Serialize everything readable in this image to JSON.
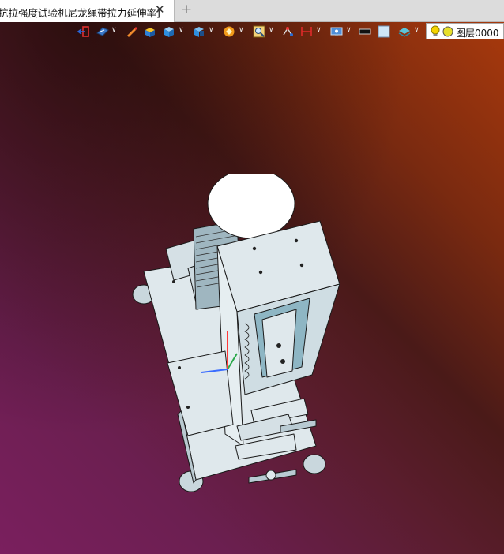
{
  "tab": {
    "title": "抗拉强度试验机尼龙绳带拉力延伸率]",
    "close_glyph": "✕",
    "new_glyph": "+"
  },
  "toolbar": {
    "icons": [
      "exit-view-icon",
      "view-orientation-icon",
      "sketch-pen-icon",
      "solid-display-icon",
      "shaded-cube-icon",
      "section-view-icon",
      "render-mode-icon",
      "zoom-fit-icon",
      "snap-icon",
      "dimension-icon",
      "display-settings-icon",
      "color-swatch-icon",
      "background-icon",
      "layer-stack-icon"
    ]
  },
  "layer": {
    "label": "图层0000",
    "bulb_color": "#f5d400",
    "dot_color": "#e8e02a"
  },
  "colors": {
    "model_fill": "#dfe8ec",
    "model_edge": "#1a1a1a",
    "part_blue": "#8eb6c4"
  }
}
